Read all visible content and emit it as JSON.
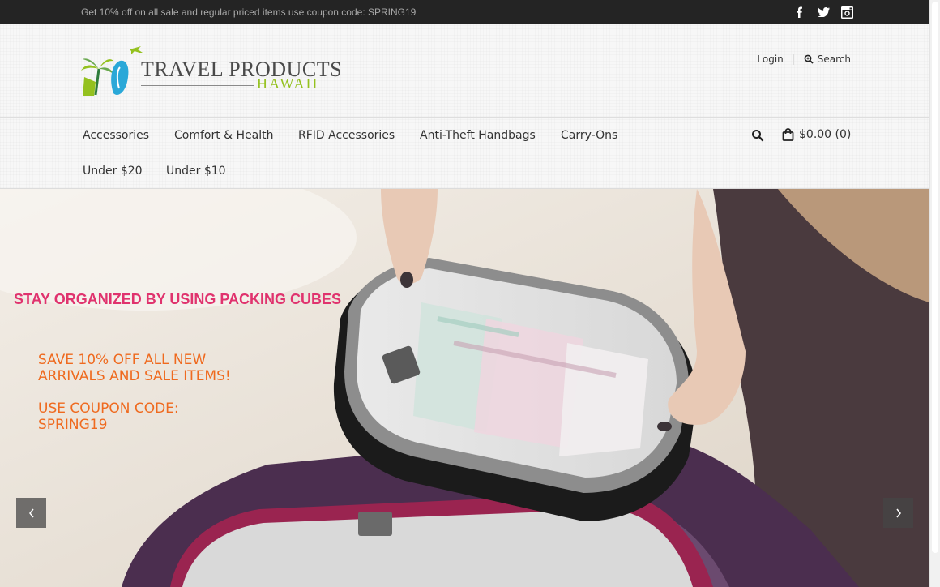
{
  "topbar": {
    "promo": "Get 10% off on all sale and regular priced items use coupon code: SPRING19",
    "social": [
      {
        "icon": "facebook-icon"
      },
      {
        "icon": "twitter-icon"
      },
      {
        "icon": "instagram-icon"
      }
    ]
  },
  "logo": {
    "line1": "TRAVEL PRODUCTS",
    "line2": "HAWAII"
  },
  "header_links": {
    "login": "Login",
    "search": "Search"
  },
  "nav": {
    "items": [
      "Accessories",
      "Comfort & Health",
      "RFID Accessories",
      "Anti-Theft Handbags",
      "Carry-Ons",
      "Under $20",
      "Under $10"
    ],
    "cart": "$0.00 (0)"
  },
  "hero": {
    "headline": "STAY ORGANIZED BY USING PACKING CUBES",
    "line1": "SAVE 10% OFF ALL NEW",
    "line2": "ARRIVALS AND SALE ITEMS!",
    "line3": "USE COUPON CODE:",
    "line4": "SPRING19"
  },
  "colors": {
    "topbar": "#242424",
    "headline": "#e0336e",
    "promo_text": "#ef6a1f",
    "logo_green": "#94c11f",
    "logo_blue": "#2aa8d8"
  }
}
